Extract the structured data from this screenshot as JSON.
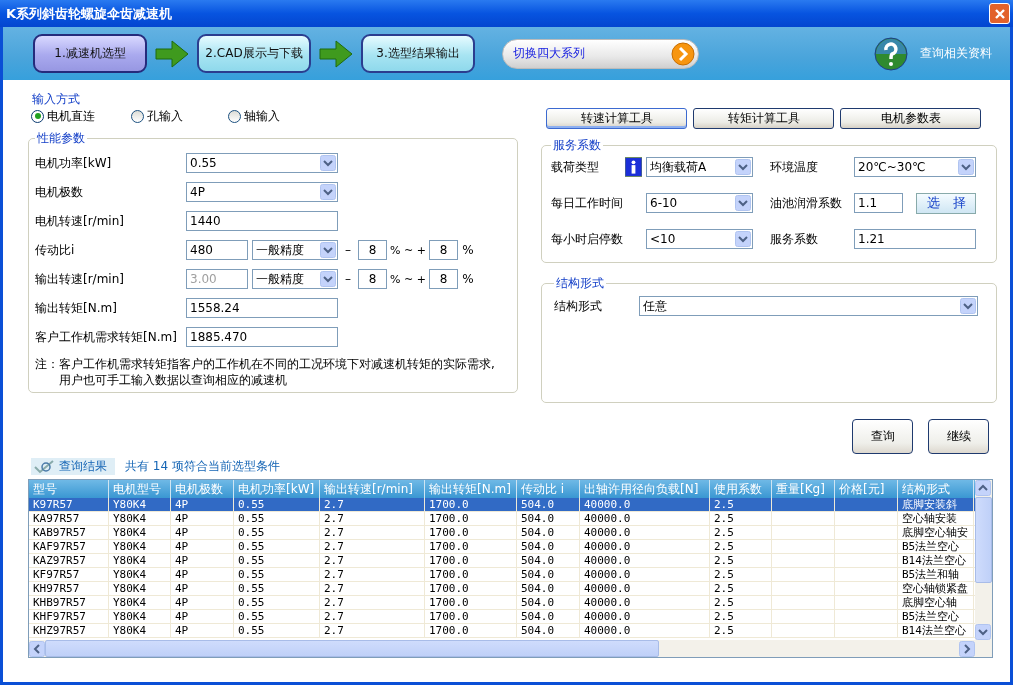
{
  "window": {
    "title": "K系列斜齿轮螺旋伞齿减速机"
  },
  "steps": [
    {
      "label": "1.减速机选型",
      "selected": true
    },
    {
      "label": "2.CAD展示与下载",
      "selected": false
    },
    {
      "label": "3.选型结果输出",
      "selected": false
    }
  ],
  "switch_series": {
    "label": "切换四大系列"
  },
  "help_link": {
    "label": "查询相关资料"
  },
  "input_mode": {
    "title": "输入方式",
    "options": [
      {
        "label": "电机直连",
        "selected": true
      },
      {
        "label": "孔输入",
        "selected": false
      },
      {
        "label": "轴输入",
        "selected": false
      }
    ]
  },
  "performance": {
    "title": "性能参数",
    "fields": [
      {
        "kind": "select",
        "label": "电机功率[kW]",
        "value": "0.55"
      },
      {
        "kind": "select",
        "label": "电机极数",
        "value": "4P"
      },
      {
        "kind": "text",
        "label": "电机转速[r/min]",
        "value": "1440"
      },
      {
        "kind": "range",
        "label": "传动比i",
        "value": "480",
        "disabled": false,
        "precision": "一般精度",
        "minus_sign": "–",
        "minus": "8",
        "between": "% ~ +",
        "plus": "8",
        "unit": "%"
      },
      {
        "kind": "range",
        "label": "输出转速[r/min]",
        "value": "3.00",
        "disabled": true,
        "precision": "一般精度",
        "minus_sign": "–",
        "minus": "8",
        "between": "% ~ +",
        "plus": "8",
        "unit": "%"
      },
      {
        "kind": "text",
        "label": "输出转矩[N.m]",
        "value": "1558.24"
      },
      {
        "kind": "text",
        "label": "客户工作机需求转矩[N.m]",
        "value": "1885.470"
      }
    ],
    "note": [
      "注：客户工作机需求转矩指客户的工作机在不同的工况环境下对减速机转矩的实际需求,",
      "用户也可手工输入数据以查询相应的减速机"
    ]
  },
  "tool_buttons": [
    "转速计算工具",
    "转矩计算工具",
    "电机参数表"
  ],
  "service": {
    "title": "服务系数",
    "fields": [
      {
        "kind": "select",
        "label": "载荷类型",
        "value": "均衡载荷A",
        "info": true
      },
      {
        "kind": "select",
        "label": "环境温度",
        "value": "20℃~30℃"
      },
      {
        "kind": "select",
        "label": "每日工作时间",
        "value": "6-10"
      },
      {
        "kind": "text",
        "label": "油池润滑系数",
        "value": "1.1",
        "button": "选　择"
      },
      {
        "kind": "select",
        "label": "每小时启停数",
        "value": "<10"
      },
      {
        "kind": "text",
        "label": "服务系数",
        "value": "1.21"
      }
    ]
  },
  "structure": {
    "title": "结构形式",
    "label": "结构形式",
    "value": "任意"
  },
  "action_buttons": [
    "查询",
    "继续"
  ],
  "results": {
    "title": "查询结果",
    "summary": "共有 14 项符合当前选型条件",
    "columns": [
      "型号",
      "电机型号",
      "电机极数",
      "电机功率[kW]",
      "输出转速[r/min]",
      "输出转矩[N.m]",
      "传动比 i",
      "出轴许用径向负载[N]",
      "使用系数",
      "重量[Kg]",
      "价格[元]",
      "结构形式"
    ],
    "rows": [
      {
        "selected": true,
        "cells": [
          "K97R57",
          "Y80K4",
          "4P",
          "0.55",
          "2.7",
          "1700.0",
          "504.0",
          "40000.0",
          "2.5",
          "",
          "",
          "底脚安装斜"
        ]
      },
      {
        "selected": false,
        "cells": [
          "KA97R57",
          "Y80K4",
          "4P",
          "0.55",
          "2.7",
          "1700.0",
          "504.0",
          "40000.0",
          "2.5",
          "",
          "",
          "空心轴安装"
        ]
      },
      {
        "selected": false,
        "cells": [
          "KAB97R57",
          "Y80K4",
          "4P",
          "0.55",
          "2.7",
          "1700.0",
          "504.0",
          "40000.0",
          "2.5",
          "",
          "",
          "底脚空心轴安"
        ]
      },
      {
        "selected": false,
        "cells": [
          "KAF97R57",
          "Y80K4",
          "4P",
          "0.55",
          "2.7",
          "1700.0",
          "504.0",
          "40000.0",
          "2.5",
          "",
          "",
          "B5法兰空心"
        ]
      },
      {
        "selected": false,
        "cells": [
          "KAZ97R57",
          "Y80K4",
          "4P",
          "0.55",
          "2.7",
          "1700.0",
          "504.0",
          "40000.0",
          "2.5",
          "",
          "",
          "B14法兰空心"
        ]
      },
      {
        "selected": false,
        "cells": [
          "KF97R57",
          "Y80K4",
          "4P",
          "0.55",
          "2.7",
          "1700.0",
          "504.0",
          "40000.0",
          "2.5",
          "",
          "",
          "B5法兰和轴"
        ]
      },
      {
        "selected": false,
        "cells": [
          "KH97R57",
          "Y80K4",
          "4P",
          "0.55",
          "2.7",
          "1700.0",
          "504.0",
          "40000.0",
          "2.5",
          "",
          "",
          "空心轴锁紧盘"
        ]
      },
      {
        "selected": false,
        "cells": [
          "KHB97R57",
          "Y80K4",
          "4P",
          "0.55",
          "2.7",
          "1700.0",
          "504.0",
          "40000.0",
          "2.5",
          "",
          "",
          "底脚空心轴"
        ]
      },
      {
        "selected": false,
        "cells": [
          "KHF97R57",
          "Y80K4",
          "4P",
          "0.55",
          "2.7",
          "1700.0",
          "504.0",
          "40000.0",
          "2.5",
          "",
          "",
          "B5法兰空心"
        ]
      },
      {
        "selected": false,
        "cells": [
          "KHZ97R57",
          "Y80K4",
          "4P",
          "0.55",
          "2.7",
          "1700.0",
          "504.0",
          "40000.0",
          "2.5",
          "",
          "",
          "B14法兰空心"
        ]
      }
    ]
  }
}
